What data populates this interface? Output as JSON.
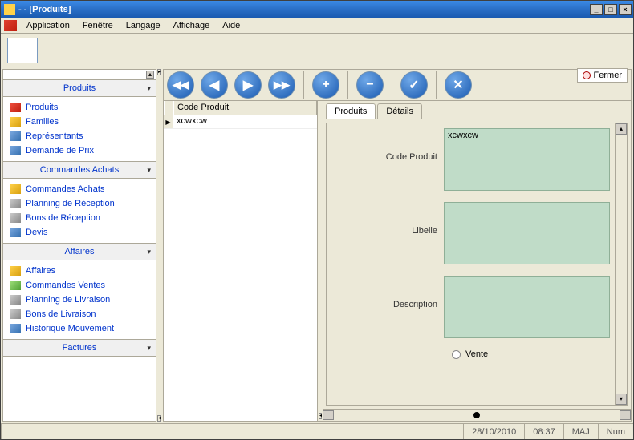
{
  "window": {
    "title": " - - [Produits]"
  },
  "menu": {
    "items": [
      "Application",
      "Fenêtre",
      "Langage",
      "Affichage",
      "Aide"
    ]
  },
  "sidebar": {
    "groups": [
      {
        "title": "Produits",
        "items": [
          {
            "label": "Produits",
            "icon": "ic-red"
          },
          {
            "label": "Familles",
            "icon": "ic-yel"
          },
          {
            "label": "Représentants",
            "icon": "ic-blu"
          },
          {
            "label": "Demande de Prix",
            "icon": "ic-blu"
          }
        ]
      },
      {
        "title": "Commandes Achats",
        "items": [
          {
            "label": "Commandes Achats",
            "icon": "ic-yel"
          },
          {
            "label": "Planning de Réception",
            "icon": "ic-gry"
          },
          {
            "label": "Bons de Réception",
            "icon": "ic-gry"
          },
          {
            "label": "Devis",
            "icon": "ic-blu"
          }
        ]
      },
      {
        "title": "Affaires",
        "items": [
          {
            "label": "Affaires",
            "icon": "ic-yel"
          },
          {
            "label": "Commandes Ventes",
            "icon": "ic-grn"
          },
          {
            "label": "Planning de Livraison",
            "icon": "ic-gry"
          },
          {
            "label": "Bons de Livraison",
            "icon": "ic-gry"
          },
          {
            "label": "Historique Mouvement",
            "icon": "ic-blu"
          }
        ]
      },
      {
        "title": "Factures",
        "items": []
      }
    ]
  },
  "nav": {
    "close_label": "Fermer"
  },
  "grid": {
    "column": "Code Produit",
    "rows": [
      {
        "value": "xcwxcw"
      }
    ]
  },
  "tabs": {
    "t1": "Produits",
    "t2": "Détails"
  },
  "form": {
    "code_label": "Code Produit",
    "code_value": "xcwxcw",
    "libelle_label": "Libelle",
    "desc_label": "Description",
    "vente_label": "Vente"
  },
  "status": {
    "date": "28/10/2010",
    "time": "08:37",
    "maj": "MAJ",
    "num": "Num"
  }
}
